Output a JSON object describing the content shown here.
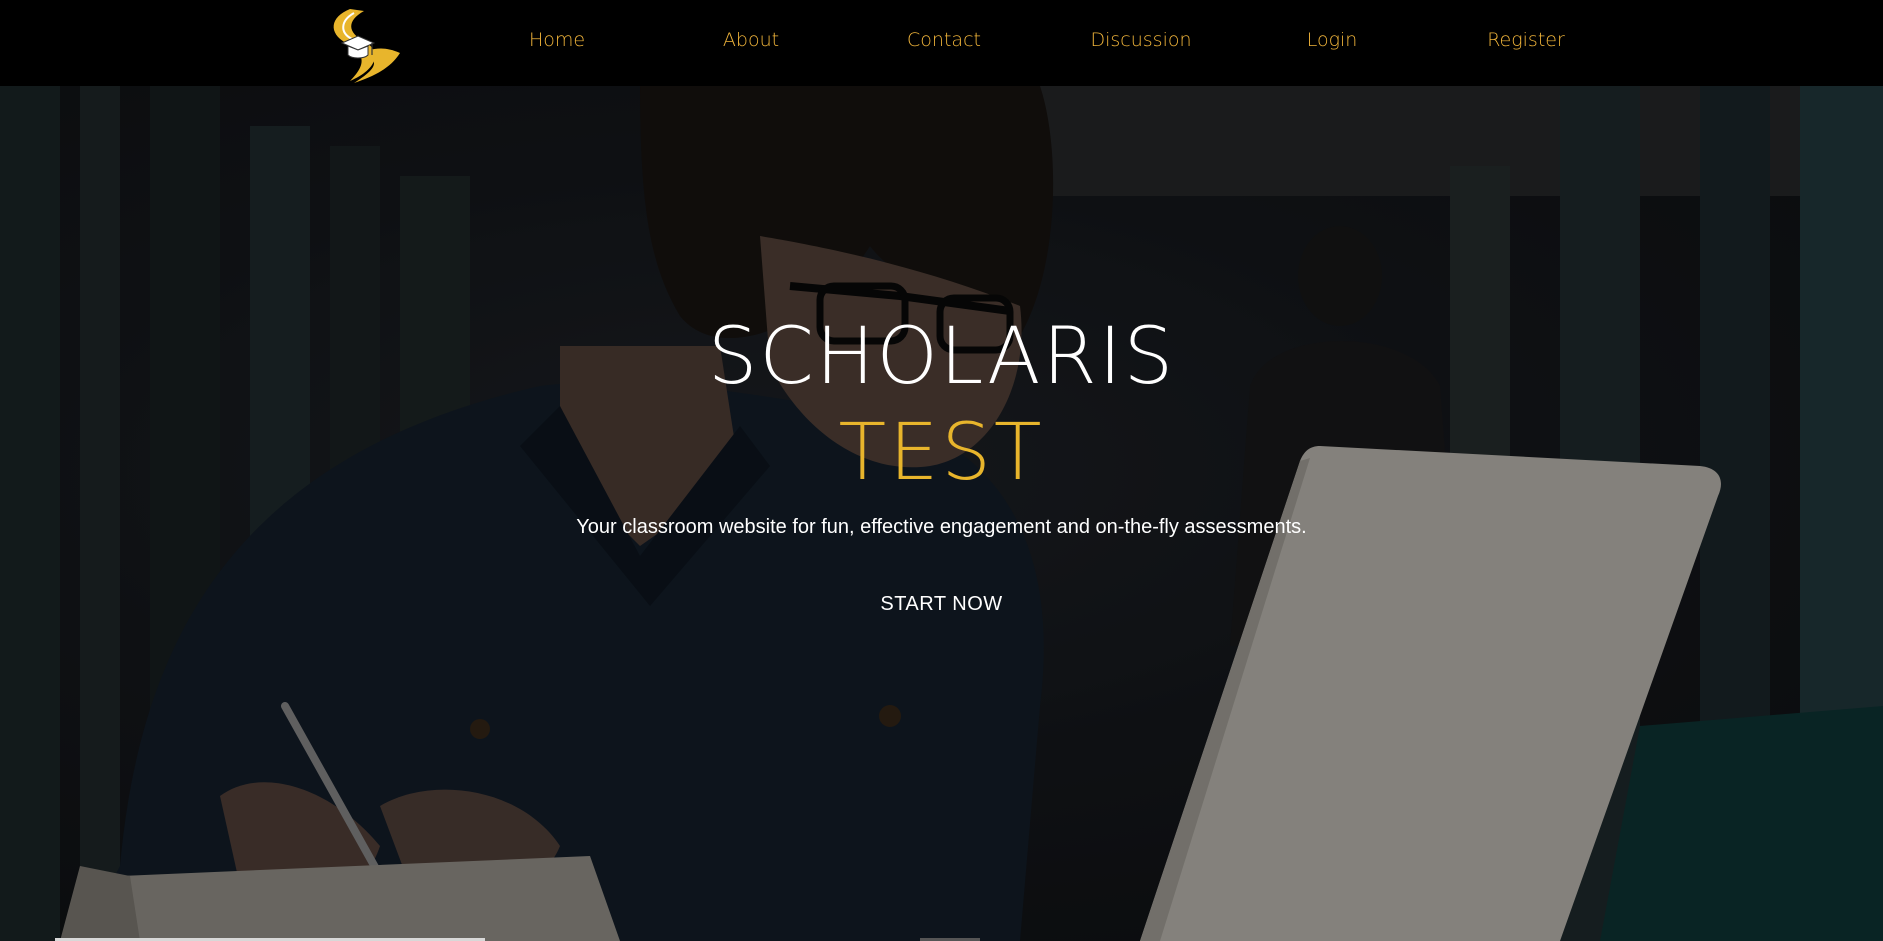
{
  "nav": {
    "logo_icon": "scholaris-logo-icon",
    "links": [
      {
        "label": "Home"
      },
      {
        "label": "About"
      },
      {
        "label": "Contact"
      },
      {
        "label": "Discussion"
      },
      {
        "label": "Login"
      },
      {
        "label": "Register"
      }
    ]
  },
  "hero": {
    "title": "SCHOLARIS",
    "subtitle": "TEST",
    "tagline": "Your classroom website for fun, effective engagement and on-the-fly assessments.",
    "cta_label": "START NOW",
    "background_description_icon": "student-laptop-photo"
  },
  "colors": {
    "nav_background": "#000000",
    "nav_link": "#f0b43a",
    "accent": "#e8b52c",
    "text": "#ffffff"
  }
}
